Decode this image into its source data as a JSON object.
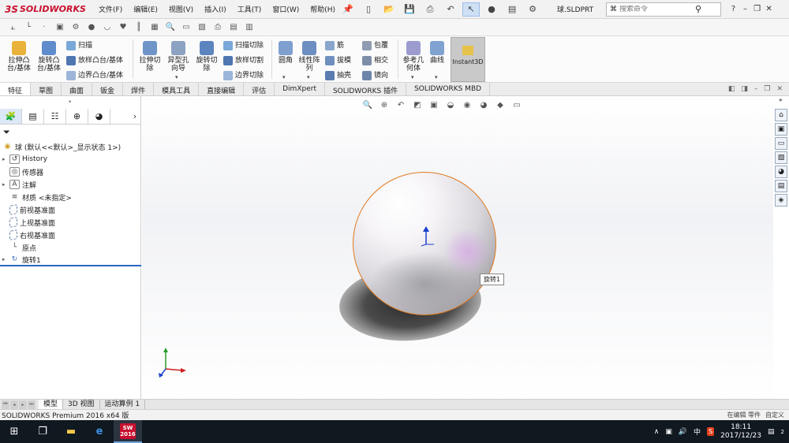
{
  "app": {
    "brand_prefix": "3S",
    "brand_name": "SOLIDWORKS",
    "document_title": "球.SLDPRT",
    "search_placeholder": "搜索命令",
    "help_icon": "?",
    "brand_color": "#c8102e"
  },
  "menu": [
    "文件(F)",
    "编辑(E)",
    "视图(V)",
    "插入(I)",
    "工具(T)",
    "窗口(W)",
    "帮助(H)"
  ],
  "ribbon": {
    "extrude_boss": "拉伸凸\n台/基体",
    "revolve_boss": "旋转凸\n台/基体",
    "sweep": "扫描",
    "loft": "放样凸台/基体",
    "boundary": "边界凸台/基体",
    "extrude_cut": "拉伸切\n除",
    "hole_wizard": "异型孔\n向导",
    "revolve_cut": "旋转切\n除",
    "swept_cut": "扫描切除",
    "lofted_cut": "放样切割",
    "boundary_cut": "边界切除",
    "fillet": "圆角",
    "linear_pattern": "线性阵\n列",
    "rib": "筋",
    "draft": "拔模",
    "shell": "抽壳",
    "wrap": "包覆",
    "intersect": "相交",
    "mirror": "镜向",
    "ref_geometry": "参考几\n何体",
    "curves": "曲线",
    "instant3d": "Instant3D"
  },
  "tabs": [
    "特征",
    "草图",
    "曲面",
    "钣金",
    "焊件",
    "模具工具",
    "直接编辑",
    "评估",
    "DimXpert",
    "SOLIDWORKS 插件",
    "SOLIDWORKS MBD"
  ],
  "tree": {
    "root": "球  (默认<<默认>_显示状态 1>)",
    "items": [
      {
        "label": "History",
        "expandable": true
      },
      {
        "label": "传感器",
        "expandable": false
      },
      {
        "label": "注解",
        "expandable": true
      },
      {
        "label": "材质 <未指定>",
        "expandable": false
      },
      {
        "label": "前视基准面",
        "expandable": false
      },
      {
        "label": "上视基准面",
        "expandable": false
      },
      {
        "label": "右视基准面",
        "expandable": false
      },
      {
        "label": "原点",
        "expandable": false
      },
      {
        "label": "旋转1",
        "expandable": true
      }
    ]
  },
  "viewport": {
    "tooltip": "旋转1",
    "edge_color": "#e07a1f"
  },
  "model_tabs": [
    "模型",
    "3D 视图",
    "运动算例 1"
  ],
  "status": {
    "text": "SOLIDWORKS Premium 2016 x64 版",
    "right": [
      "在编辑 零件",
      "自定义"
    ]
  },
  "taskbar": {
    "app_badge": "SW\n2016",
    "ime": "中",
    "time": "18:11",
    "date": "2017/12/23",
    "notifications": "2"
  }
}
